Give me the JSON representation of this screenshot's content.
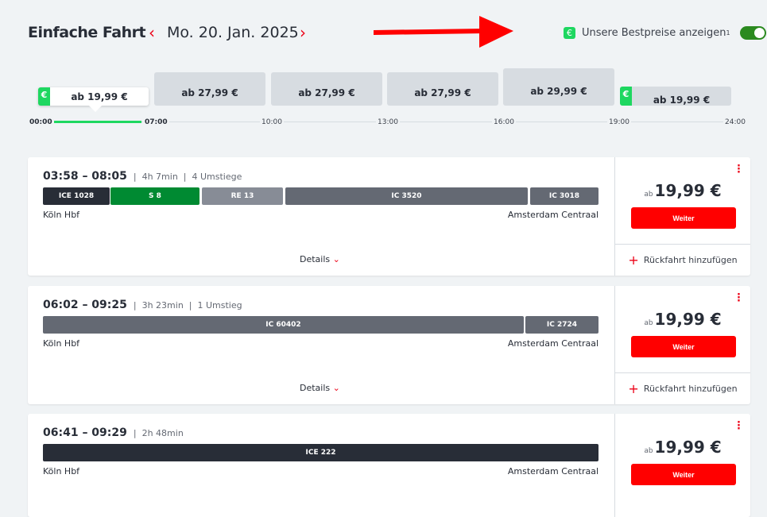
{
  "header": {
    "title": "Einfache Fahrt",
    "date": "Mo. 20. Jan. 2025",
    "prev_icon": "‹",
    "next_icon": "›",
    "bestprice_label": "Unsere Bestpreise anzeigen",
    "bestprice_sup": "1",
    "bestprice_enabled": true,
    "euro_icon": "€"
  },
  "colors": {
    "accent": "#ec0016",
    "bestprice": "#1ed760",
    "ice": "#282d37",
    "s": "#008a32",
    "re": "#878c96",
    "ic": "#646973"
  },
  "price_slots": [
    {
      "label": "ab 19,99 €",
      "selected": true,
      "bestprice": true
    },
    {
      "label": "ab 27,99 €"
    },
    {
      "label": "ab 27,99 €"
    },
    {
      "label": "ab 27,99 €"
    },
    {
      "label": "ab 29,99 €"
    },
    {
      "label": "ab 19,99 €",
      "bestprice": true
    }
  ],
  "timeline": [
    "00:00",
    "07:00",
    "10:00",
    "13:00",
    "16:00",
    "19:00",
    "24:00"
  ],
  "connections": [
    {
      "times": "03:58 – 08:05",
      "duration": "4h 7min",
      "transfers": "4 Umstiege",
      "from": "Köln Hbf",
      "to": "Amsterdam Centraal",
      "segments": [
        "ICE 1028",
        "S 8",
        "RE 13",
        "IC 3520",
        "IC 3018"
      ],
      "price_prefix": "ab",
      "price": "19,99 €",
      "button": "Weiter",
      "return": "Rückfahrt hinzufügen",
      "details": "Details"
    },
    {
      "times": "06:02 – 09:25",
      "duration": "3h 23min",
      "transfers": "1 Umstieg",
      "from": "Köln Hbf",
      "to": "Amsterdam Centraal",
      "segments": [
        "IC 60402",
        "IC 2724"
      ],
      "price_prefix": "ab",
      "price": "19,99 €",
      "button": "Weiter",
      "return": "Rückfahrt hinzufügen",
      "details": "Details"
    },
    {
      "times": "06:41 – 09:29",
      "duration": "2h 48min",
      "from": "Köln Hbf",
      "to": "Amsterdam Centraal",
      "segments": [
        "ICE 222"
      ],
      "price_prefix": "ab",
      "price": "19,99 €",
      "button": "Weiter"
    }
  ]
}
